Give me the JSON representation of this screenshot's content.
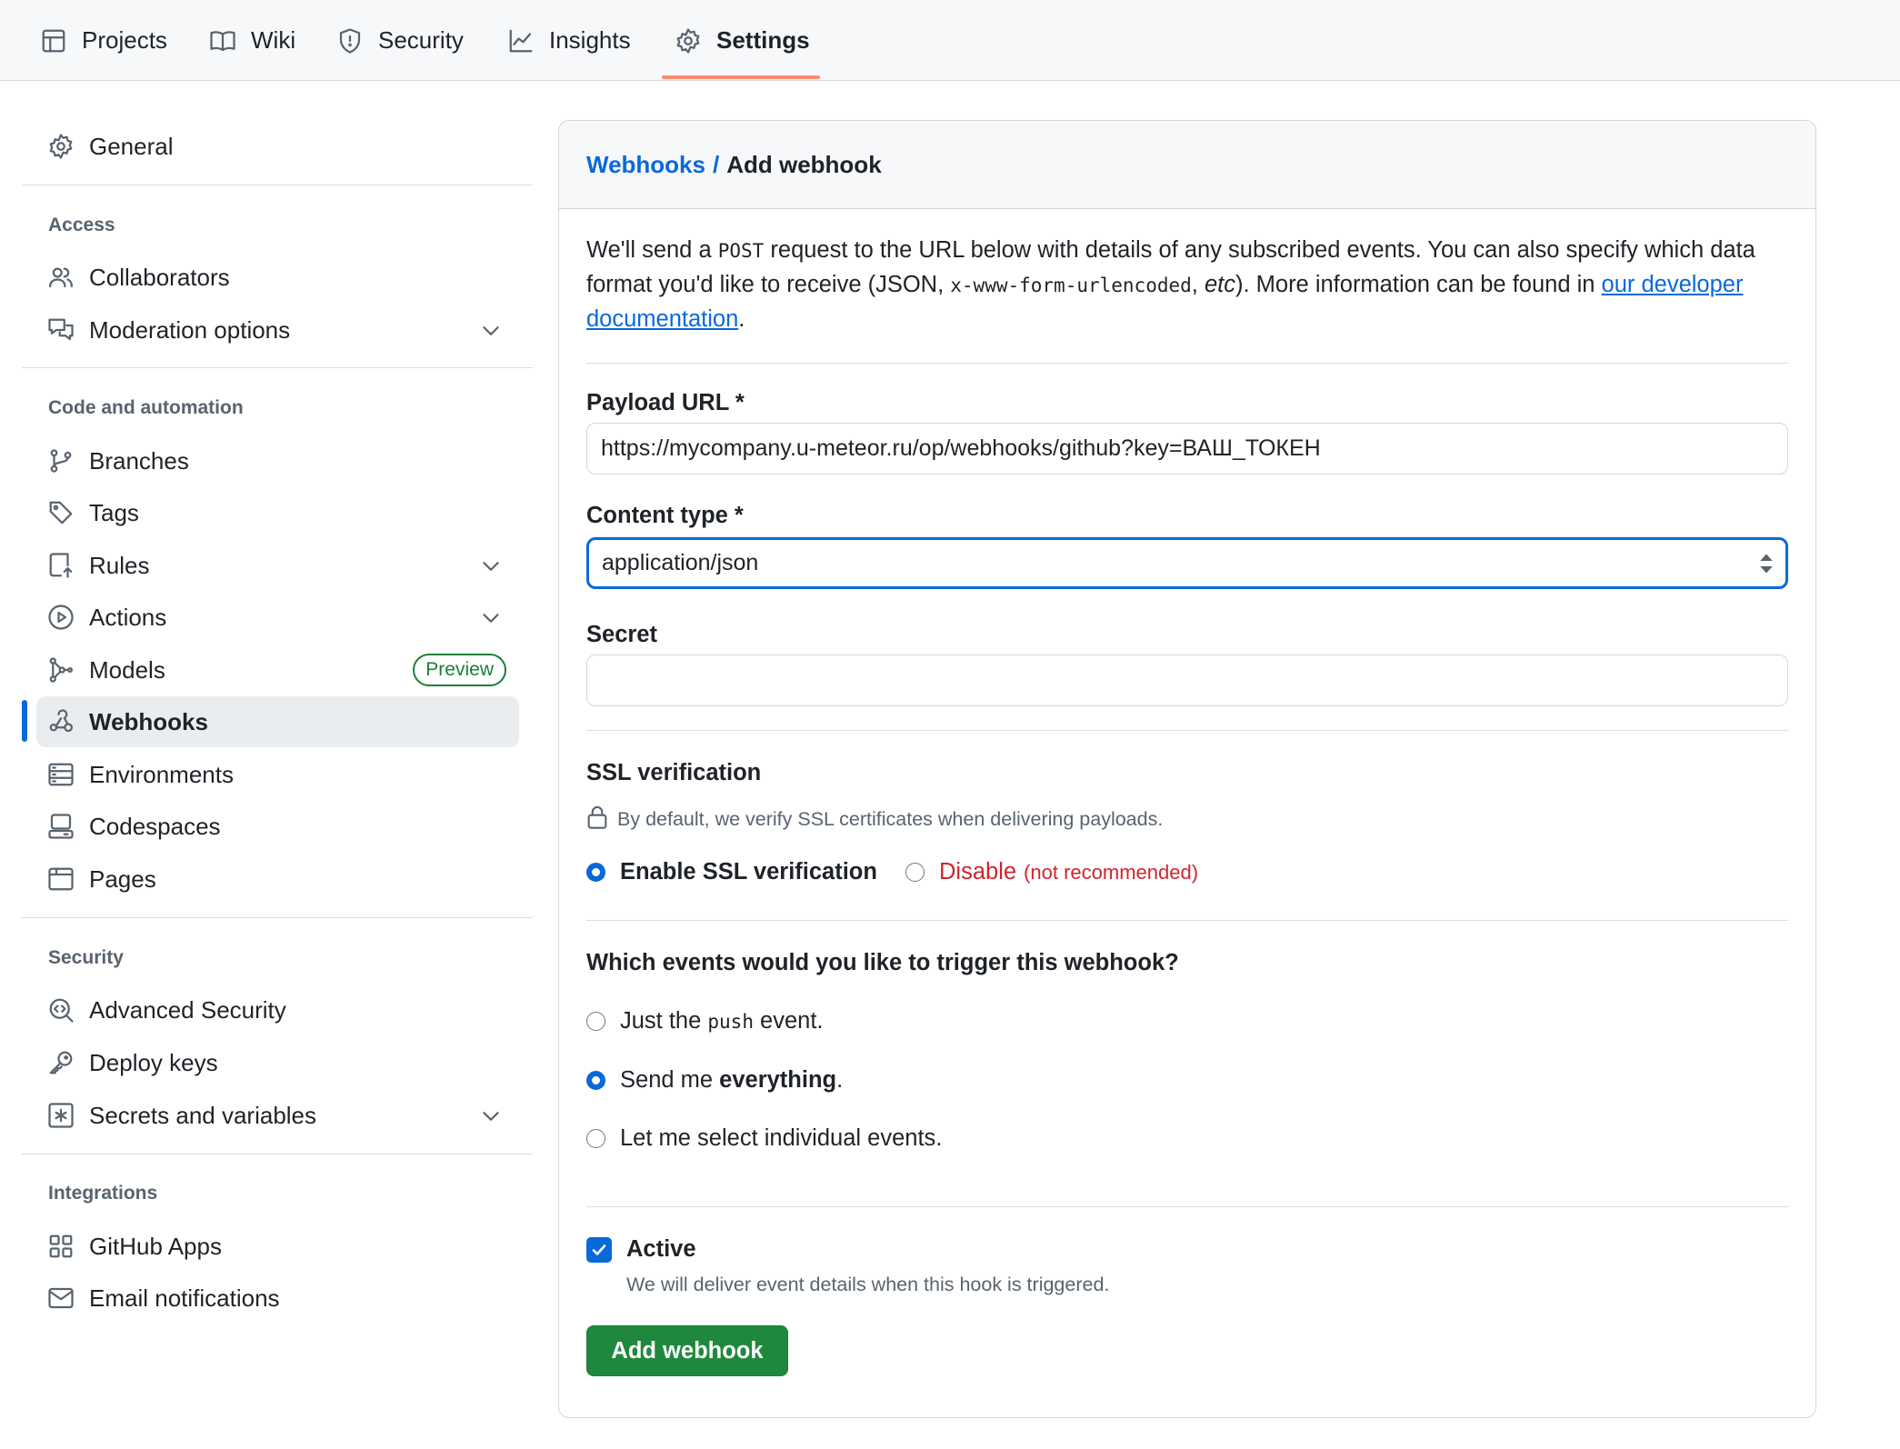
{
  "topnav": {
    "tabs": [
      {
        "label": "Projects",
        "icon": "table-icon"
      },
      {
        "label": "Wiki",
        "icon": "book-icon"
      },
      {
        "label": "Security",
        "icon": "shield-icon"
      },
      {
        "label": "Insights",
        "icon": "graph-icon"
      },
      {
        "label": "Settings",
        "icon": "gear-icon",
        "selected": true
      }
    ],
    "selected_underline_color": "#fd8c73"
  },
  "sidebar": {
    "general": "General",
    "sections": {
      "access": "Access",
      "code": "Code and automation",
      "security": "Security",
      "integrations": "Integrations"
    },
    "items": {
      "collaborators": "Collaborators",
      "moderation": "Moderation options",
      "branches": "Branches",
      "tags": "Tags",
      "rules": "Rules",
      "actions": "Actions",
      "models": "Models",
      "models_badge": "Preview",
      "webhooks": "Webhooks",
      "environments": "Environments",
      "codespaces": "Codespaces",
      "pages": "Pages",
      "advanced_security": "Advanced Security",
      "deploy_keys": "Deploy keys",
      "secrets": "Secrets and variables",
      "github_apps": "GitHub Apps",
      "email_notifications": "Email notifications"
    },
    "active_item": "Webhooks",
    "accent": "#0969da"
  },
  "main": {
    "breadcrumb": {
      "parent": "Webhooks",
      "separator": "/",
      "current": "Add webhook"
    },
    "intro": {
      "p1": "We'll send a ",
      "code1": "POST",
      "p2": " request to the URL below with details of any subscribed events. You can also specify which data format you'd like to receive (JSON, ",
      "code2": "x-www-form-urlencoded",
      "p3": ", ",
      "etc": "etc",
      "p4": "). More information can be found in ",
      "link": "our developer documentation",
      "p5": "."
    },
    "payload_url": {
      "label": "Payload URL *",
      "value": "https://mycompany.u-meteor.ru/op/webhooks/github?key=ВАШ_ТОКЕН"
    },
    "content_type": {
      "label": "Content type *",
      "selected": "application/json"
    },
    "secret": {
      "label": "Secret",
      "value": ""
    },
    "ssl": {
      "heading": "SSL verification",
      "help": "By default, we verify SSL certificates when delivering payloads.",
      "enable_label": "Enable SSL verification",
      "disable_label": "Disable",
      "disable_note": "(not recommended)",
      "selected": "enable",
      "danger_color": "#d1242f"
    },
    "events": {
      "heading": "Which events would you like to trigger this webhook?",
      "opt1_pre": "Just the ",
      "opt1_code": "push",
      "opt1_post": " event.",
      "opt2_pre": "Send me ",
      "opt2_bold": "everything",
      "opt2_post": ".",
      "opt3": "Let me select individual events.",
      "selected": "everything"
    },
    "active": {
      "label": "Active",
      "checked": true,
      "help": "We will deliver event details when this hook is triggered."
    },
    "submit_label": "Add webhook",
    "submit_color": "#1f883d"
  }
}
